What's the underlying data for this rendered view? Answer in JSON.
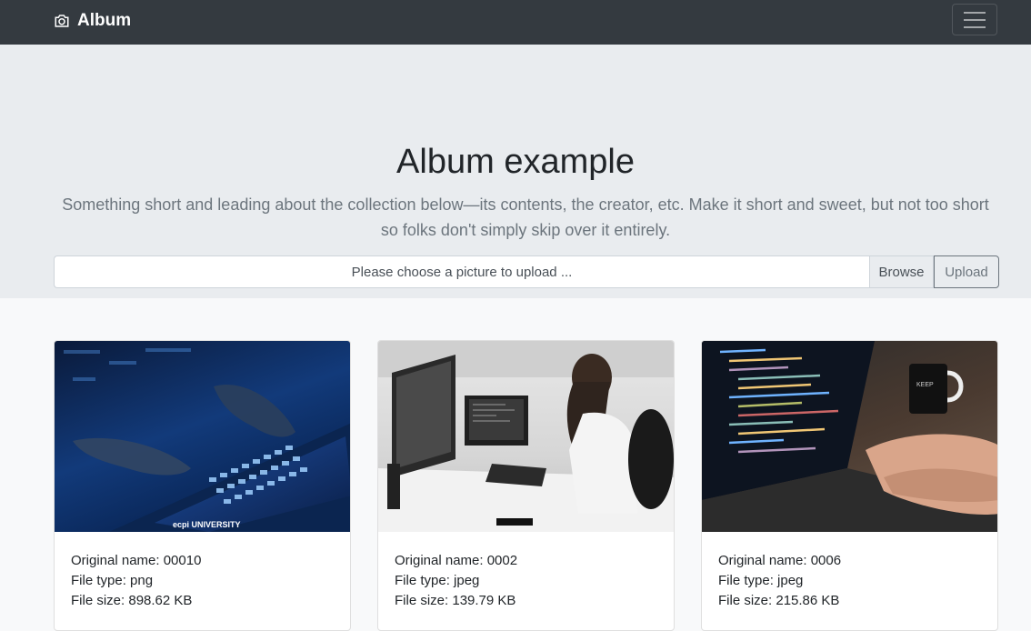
{
  "navbar": {
    "brand_label": "Album",
    "brand_icon": "camera-icon",
    "toggler_icon": "hamburger-menu-icon"
  },
  "jumbotron": {
    "title": "Album example",
    "lead": "Something short and leading about the collection below—its contents, the creator, etc. Make it short and sweet, but not too short so folks don't simply skip over it entirely."
  },
  "upload": {
    "placeholder": "Please choose a picture to upload ...",
    "browse_label": "Browse",
    "upload_label": "Upload"
  },
  "cards": [
    {
      "image_alt": "hands typing on a glowing laptop keyboard",
      "image_caption": "ecpi UNIVERSITY",
      "original_name": "Original name: 00010",
      "file_type": "File type: png",
      "file_size": "File size: 898.62 KB"
    },
    {
      "image_alt": "woman working at a desk with two monitors",
      "original_name": "Original name: 0002",
      "file_type": "File type: jpeg",
      "file_size": "File size: 139.79 KB"
    },
    {
      "image_alt": "hands typing on laptop showing code with coffee mug",
      "original_name": "Original name: 0006",
      "file_type": "File type: jpeg",
      "file_size": "File size: 215.86 KB"
    }
  ],
  "colors": {
    "navbar_bg": "#343a40",
    "jumbotron_bg": "#e9ecef",
    "page_bg": "#f8f9fa",
    "muted_text": "#6c757d"
  }
}
